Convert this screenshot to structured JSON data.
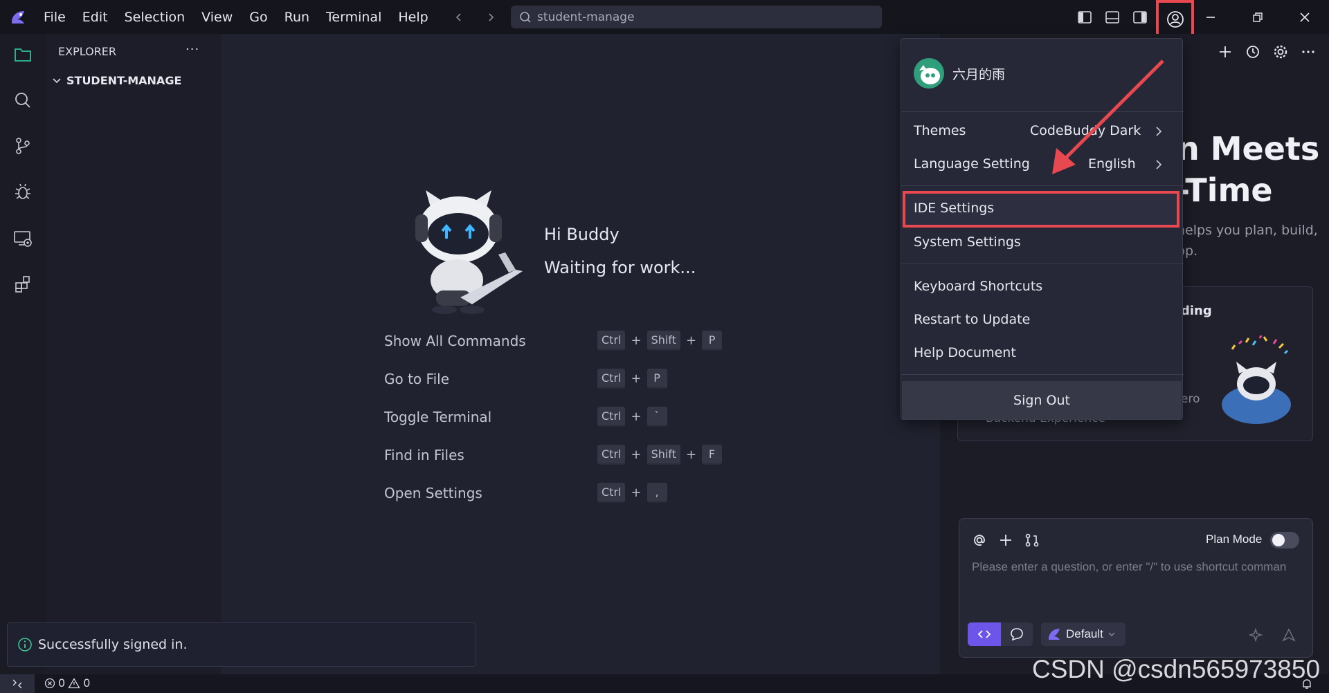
{
  "menu": [
    "File",
    "Edit",
    "Selection",
    "View",
    "Go",
    "Run",
    "Terminal",
    "Help"
  ],
  "search": {
    "text": "student-manage"
  },
  "sidebar": {
    "title": "EXPLORER",
    "more": "···",
    "folder": "STUDENT-MANAGE"
  },
  "welcome": {
    "greeting": "Hi Buddy",
    "status": "Waiting for work...",
    "shortcuts": [
      {
        "label": "Show All Commands",
        "keys": [
          "Ctrl",
          "Shift",
          "P"
        ]
      },
      {
        "label": "Go to File",
        "keys": [
          "Ctrl",
          "P"
        ]
      },
      {
        "label": "Toggle Terminal",
        "keys": [
          "Ctrl",
          "`"
        ]
      },
      {
        "label": "Find in Files",
        "keys": [
          "Ctrl",
          "Shift",
          "F"
        ]
      },
      {
        "label": "Open Settings",
        "keys": [
          "Ctrl",
          ","
        ]
      }
    ],
    "plus": "+"
  },
  "account_menu": {
    "username": "六月的雨",
    "themes_label": "Themes",
    "themes_value": "CodeBuddy Dark",
    "language_label": "Language Setting",
    "language_value": "English",
    "ide_settings": "IDE Settings",
    "system_settings": "System Settings",
    "keyboard_shortcuts": "Keyboard Shortcuts",
    "restart": "Restart to Update",
    "help": "Help Document",
    "sign_out": "Sign Out"
  },
  "right_panel": {
    "hero_line1": "n Meets",
    "hero_line2": "-Time",
    "desc_line1": "helps you plan, build,",
    "desc_line2": "pp.",
    "card_title": "ding",
    "card_zero": "ero",
    "card_sub": "Backend Experience"
  },
  "chat": {
    "plan_mode": "Plan Mode",
    "placeholder": "Please enter a question, or enter \"/\" to use shortcut comman",
    "model": "Default"
  },
  "toast": {
    "message": "Successfully signed in."
  },
  "statusbar": {
    "errors": "0",
    "warnings": "0"
  },
  "watermark": "CSDN @csdn565973850",
  "colors": {
    "accent": "#6c55e8",
    "highlight": "#e8484f",
    "avatar": "#2f9e7a"
  },
  "icons": {
    "activity": [
      "explorer-icon",
      "search-icon",
      "source-control-icon",
      "debug-icon",
      "remote-explorer-icon",
      "extensions-icon"
    ],
    "titlebar": [
      "toggle-primary-sidebar-icon",
      "toggle-panel-icon",
      "toggle-secondary-sidebar-icon",
      "account-icon"
    ]
  }
}
